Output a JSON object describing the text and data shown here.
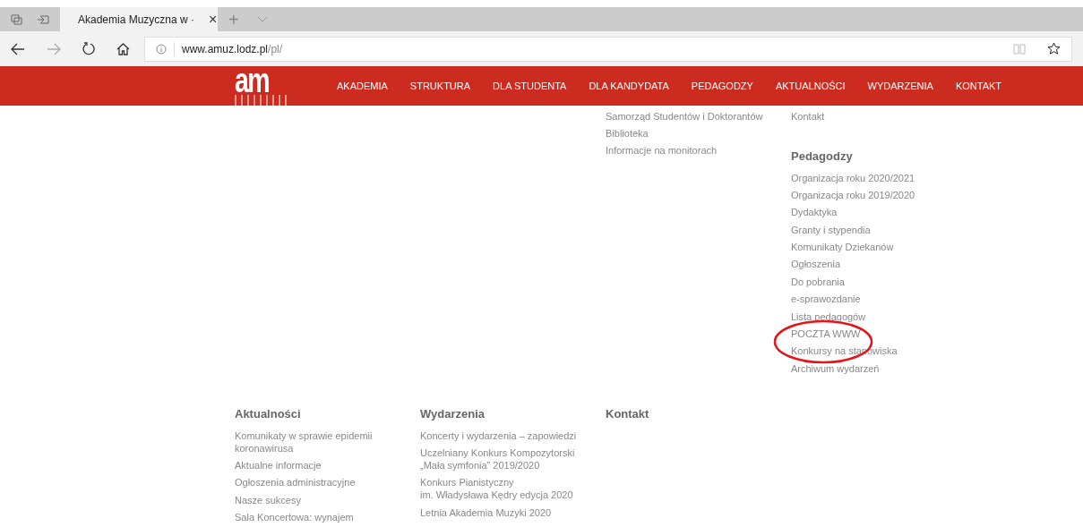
{
  "browser": {
    "tabs": [
      {
        "title": "Akademia Muzyczna w ·",
        "selected": true,
        "close": "×"
      }
    ],
    "new_tab": "+",
    "address": {
      "domain": "www.amuz.lodz.pl",
      "path": "/pl/"
    }
  },
  "nav": {
    "logo_text": "am",
    "items": [
      "AKADEMIA",
      "STRUKTURA",
      "DLA STUDENTA",
      "DLA KANDYDATA",
      "PEDAGODZY",
      "AKTUALNOŚCI",
      "WYDARZENIA",
      "KONTAKT"
    ]
  },
  "upper": {
    "column_3": {
      "links": [
        "Samorząd Studentów i Doktorantów",
        "Biblioteka",
        "Informacje na monitorach"
      ]
    },
    "column_4": {
      "links": [
        "Kontakt"
      ],
      "section": {
        "heading": "Pedagodzy",
        "links": [
          {
            "text": "Organizacja roku 2020/2021",
            "circled": false
          },
          {
            "text": "Organizacja roku 2019/2020",
            "circled": false
          },
          {
            "text": "Dydaktyka",
            "circled": false
          },
          {
            "text": "Granty i stypendia",
            "circled": false
          },
          {
            "text": "Komunikaty Dziekanów",
            "circled": false
          },
          {
            "text": "Ogłoszenia",
            "circled": false
          },
          {
            "text": "Do pobrania",
            "circled": false
          },
          {
            "text": "e-sprawozdanie",
            "circled": false
          },
          {
            "text": "Lista pedagogów",
            "circled": false
          },
          {
            "text": "POCZTA WWW",
            "circled": true
          },
          {
            "text": "Konkursy na stanowiska",
            "circled": false
          },
          {
            "text": "Archiwum wydarzeń",
            "circled": false
          }
        ]
      }
    }
  },
  "footer": [
    {
      "heading": "Aktualności",
      "links": [
        "Komunikaty w sprawie epidemii\nkoronawirusa",
        "Aktualne informacje",
        "Ogłoszenia administracyjne",
        "Nasze sukcesy",
        "Sala Koncertowa: wynajem"
      ]
    },
    {
      "heading": "Wydarzenia",
      "links": [
        "Koncerty i wydarzenia – zapowiedzi",
        "Uczelniany Konkurs Kompozytorski\n„Mała symfonia” 2019/2020",
        "Konkurs Pianistyczny\nim. Władysława Kędry edycja 2020",
        "Letnia Akademia Muzyki 2020"
      ]
    },
    {
      "heading": "Kontakt"
    }
  ]
}
